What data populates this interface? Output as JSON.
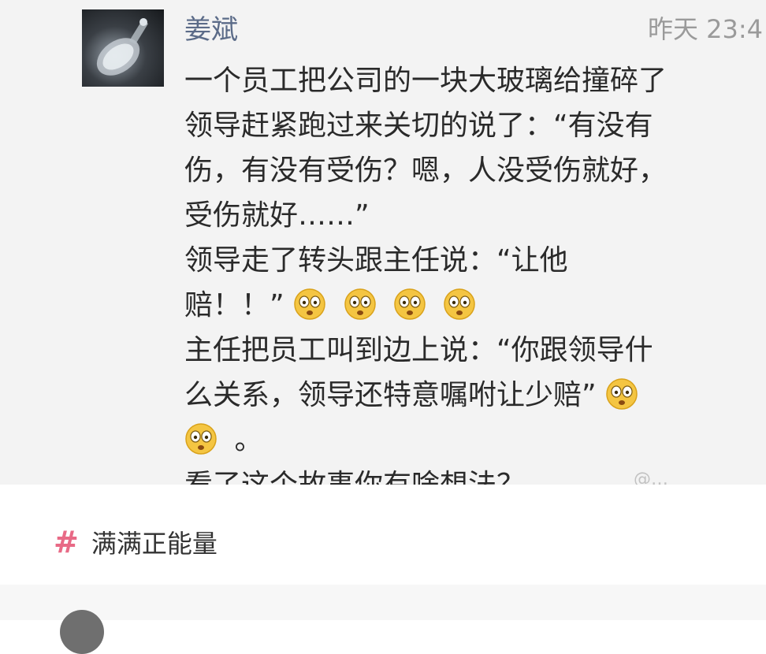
{
  "post": {
    "author": "姜斌",
    "time": "昨天 23:4",
    "lines": [
      "一个员工把公司的一块大玻璃给撞碎了",
      "领导赶紧跑过来关切的说了：“有没有",
      "伤，有没有受伤？嗯，人没受伤就好，",
      "受伤就好……”",
      "领导走了转头跟主任说：“让他",
      "赔！！”",
      "主任把员工叫到边上说：“你跟领导什",
      "么关系，领导还特意嘱咐让少赔”",
      "。",
      "看了这个故事你有啥想法？"
    ],
    "emoji_name": "shocked-face-emoji",
    "watermark": "@…"
  },
  "hashtag": {
    "icon": "#",
    "icon_name": "hashtag-icon",
    "label": "满满正能量",
    "color": "#e86a86"
  },
  "colors": {
    "author": "#5b6b88",
    "post_bg": "#f3f3f3",
    "text": "#2a2a2a"
  }
}
